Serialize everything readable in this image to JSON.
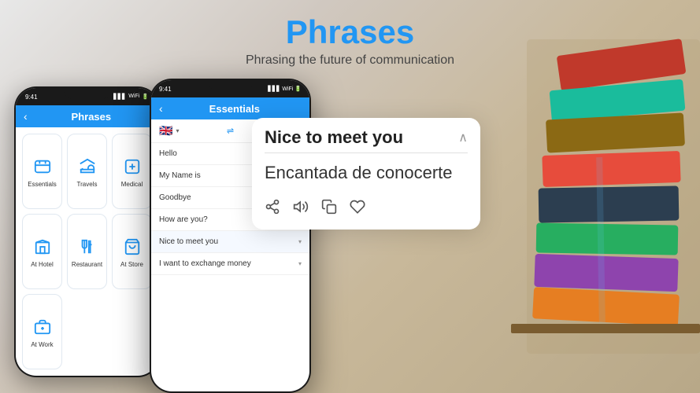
{
  "header": {
    "title": "Phrases",
    "subtitle": "Phrasing the future of communication"
  },
  "phone_left": {
    "status_time": "9:41",
    "header_title": "Phrases",
    "back_label": "‹",
    "categories": [
      {
        "label": "Essentials",
        "icon": "💬"
      },
      {
        "label": "Travels",
        "icon": "✈"
      },
      {
        "label": "Medical",
        "icon": "🏥"
      },
      {
        "label": "At Hotel",
        "icon": "🏨"
      },
      {
        "label": "Restaurant",
        "icon": "🍽"
      },
      {
        "label": "At Store",
        "icon": "🛒"
      },
      {
        "label": "At Work",
        "icon": "💼"
      }
    ]
  },
  "phone_right": {
    "status_time": "9:41",
    "header_title": "Essentials",
    "back_label": "‹",
    "phrases": [
      {
        "text": "Hello",
        "expanded": false
      },
      {
        "text": "My Name is",
        "expanded": false
      },
      {
        "text": "Goodbye",
        "expanded": false
      },
      {
        "text": "How are you?",
        "expanded": false
      },
      {
        "text": "Nice to meet you",
        "expanded": true
      },
      {
        "text": "I want to exchange money",
        "expanded": false
      }
    ]
  },
  "expanded_card": {
    "english": "Nice to meet you",
    "spanish": "Encantada de conocerte"
  },
  "colors": {
    "blue": "#2196F3",
    "dark": "#1a1a1a",
    "white": "#ffffff"
  }
}
